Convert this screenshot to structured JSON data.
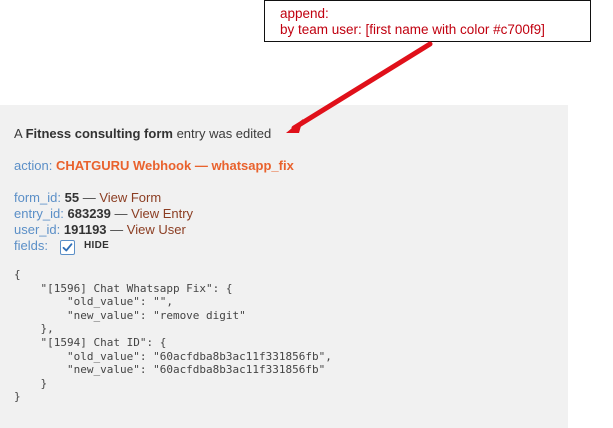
{
  "annotation": {
    "line1": "append:",
    "line2": "by team user: [first name with color #c700f9]"
  },
  "entry": {
    "prefix": "A",
    "form_name": "Fitness consulting form",
    "suffix": "entry was edited"
  },
  "action": {
    "label": "action:",
    "value": "CHATGURU Webhook — whatsapp_fix"
  },
  "meta": {
    "form_id": {
      "label": "form_id:",
      "value": "55",
      "dash": "—",
      "link": "View Form"
    },
    "entry_id": {
      "label": "entry_id:",
      "value": "683239",
      "dash": "—",
      "link": "View Entry"
    },
    "user_id": {
      "label": "user_id:",
      "value": "191193",
      "dash": "—",
      "link": "View User"
    },
    "fields": {
      "label": "fields:",
      "checked": true,
      "toggle_label": "HIDE"
    }
  },
  "fields_json": "{\n    \"[1596] Chat Whatsapp Fix\": {\n        \"old_value\": \"\",\n        \"new_value\": \"remove digit\"\n    },\n    \"[1594] Chat ID\": {\n        \"old_value\": \"60acfdba8b3ac11f331856fb\",\n        \"new_value\": \"60acfdba8b3ac11f331856fb\"\n    }\n}",
  "colors": {
    "panel_bg": "#f1f1f1",
    "label_blue": "#5b8fc7",
    "action_orange": "#e9622d",
    "link_brown": "#8b3d22",
    "annotation_red": "#c0000f",
    "arrow_red": "#e0101a"
  },
  "icons": {
    "checkbox": "check-icon",
    "arrow": "arrow-annotation"
  }
}
